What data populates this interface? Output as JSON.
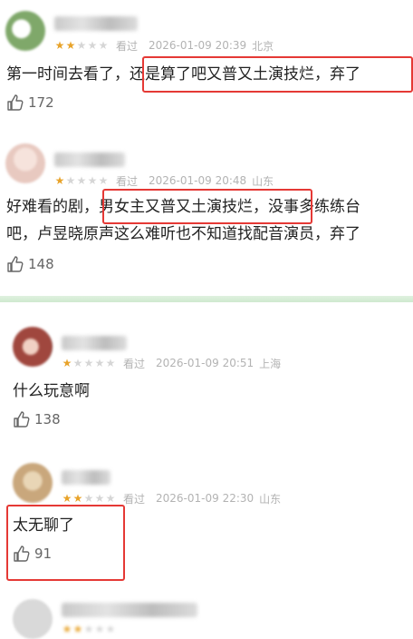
{
  "comments": [
    {
      "rating": 2,
      "watched_label": "看过",
      "timestamp": "2026-01-09 20:39",
      "location": "北京",
      "text_lines": [
        "第一时间去看了，还是算了吧又普又土演技烂，弃了"
      ],
      "likes": "172",
      "avatar_color": "#7fa86a"
    },
    {
      "rating": 1,
      "watched_label": "看过",
      "timestamp": "2026-01-09 20:48",
      "location": "山东",
      "text_lines": [
        "好难看的剧，男女主又普又土演技烂，没事多练练台",
        "吧，卢昱晓原声这么难听也不知道找配音演员，弃了"
      ],
      "likes": "148",
      "avatar_color": "#e8c9c0"
    },
    {
      "rating": 1,
      "watched_label": "看过",
      "timestamp": "2026-01-09 20:51",
      "location": "上海",
      "text_lines": [
        "什么玩意啊"
      ],
      "likes": "138",
      "avatar_color": "#a0473e"
    },
    {
      "rating": 2,
      "watched_label": "看过",
      "timestamp": "2026-01-09 22:30",
      "location": "山东",
      "text_lines": [
        "太无聊了"
      ],
      "likes": "91",
      "avatar_color": "#c9a77c"
    },
    {
      "rating": 2,
      "avatar_color": "#d9d9d9"
    }
  ],
  "colors": {
    "star_on": "#e8a32a",
    "star_off": "#d6d6d6",
    "highlight": "#e53935",
    "divider": "#d4ecd4"
  }
}
